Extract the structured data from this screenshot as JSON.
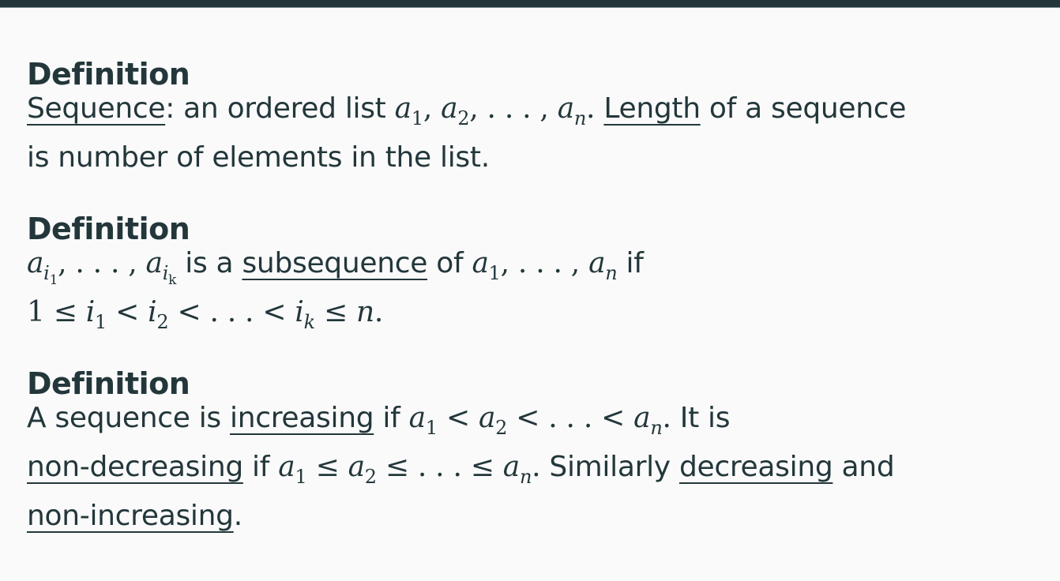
{
  "colors": {
    "text": "#23373b",
    "background": "#fafafa",
    "topbar": "#23373b"
  },
  "blocks": [
    {
      "title": "Definition",
      "lines": [
        [
          {
            "k": "u",
            "v": "Sequence"
          },
          {
            "k": "t",
            "v": ": an ordered list "
          },
          {
            "k": "m",
            "v": "a"
          },
          {
            "k": "s",
            "v": "1"
          },
          {
            "k": "r",
            "v": ", "
          },
          {
            "k": "m",
            "v": "a"
          },
          {
            "k": "s",
            "v": "2"
          },
          {
            "k": "r",
            "v": ", . . . , "
          },
          {
            "k": "m",
            "v": "a"
          },
          {
            "k": "si",
            "v": "n"
          },
          {
            "k": "r",
            "v": ". "
          },
          {
            "k": "u",
            "v": "Length"
          },
          {
            "k": "t",
            "v": " of a sequence"
          }
        ],
        [
          {
            "k": "t",
            "v": "is number of elements in the list."
          }
        ]
      ]
    },
    {
      "title": "Definition",
      "lines": [
        [
          {
            "k": "m",
            "v": "a"
          },
          {
            "k": "si",
            "v": "i"
          },
          {
            "k": "ss",
            "v": "1"
          },
          {
            "k": "r",
            "v": ", . . . , "
          },
          {
            "k": "m",
            "v": "a"
          },
          {
            "k": "si",
            "v": "i"
          },
          {
            "k": "ss",
            "v": "k"
          },
          {
            "k": "t",
            "v": " is a "
          },
          {
            "k": "u",
            "v": "subsequence"
          },
          {
            "k": "t",
            "v": " of "
          },
          {
            "k": "m",
            "v": "a"
          },
          {
            "k": "s",
            "v": "1"
          },
          {
            "k": "r",
            "v": ", . . . , "
          },
          {
            "k": "m",
            "v": "a"
          },
          {
            "k": "si",
            "v": "n"
          },
          {
            "k": "t",
            "v": " if"
          }
        ],
        [
          {
            "k": "r",
            "v": "1 ≤ "
          },
          {
            "k": "m",
            "v": "i"
          },
          {
            "k": "s",
            "v": "1"
          },
          {
            "k": "r",
            "v": " < "
          },
          {
            "k": "m",
            "v": "i"
          },
          {
            "k": "s",
            "v": "2"
          },
          {
            "k": "r",
            "v": " < . . . < "
          },
          {
            "k": "m",
            "v": "i"
          },
          {
            "k": "si",
            "v": "k"
          },
          {
            "k": "r",
            "v": " ≤ "
          },
          {
            "k": "m",
            "v": "n"
          },
          {
            "k": "r",
            "v": "."
          }
        ]
      ]
    },
    {
      "title": "Definition",
      "lines": [
        [
          {
            "k": "t",
            "v": "A sequence is "
          },
          {
            "k": "u",
            "v": "increasing"
          },
          {
            "k": "t",
            "v": " if "
          },
          {
            "k": "m",
            "v": "a"
          },
          {
            "k": "s",
            "v": "1"
          },
          {
            "k": "r",
            "v": " < "
          },
          {
            "k": "m",
            "v": "a"
          },
          {
            "k": "s",
            "v": "2"
          },
          {
            "k": "r",
            "v": " < . . . < "
          },
          {
            "k": "m",
            "v": "a"
          },
          {
            "k": "si",
            "v": "n"
          },
          {
            "k": "r",
            "v": ". "
          },
          {
            "k": "t",
            "v": "It is"
          }
        ],
        [
          {
            "k": "u",
            "v": "non-decreasing"
          },
          {
            "k": "t",
            "v": " if "
          },
          {
            "k": "m",
            "v": "a"
          },
          {
            "k": "s",
            "v": "1"
          },
          {
            "k": "r",
            "v": " ≤ "
          },
          {
            "k": "m",
            "v": "a"
          },
          {
            "k": "s",
            "v": "2"
          },
          {
            "k": "r",
            "v": " ≤ . . . ≤ "
          },
          {
            "k": "m",
            "v": "a"
          },
          {
            "k": "si",
            "v": "n"
          },
          {
            "k": "r",
            "v": ". "
          },
          {
            "k": "t",
            "v": "Similarly "
          },
          {
            "k": "u",
            "v": "decreasing"
          },
          {
            "k": "t",
            "v": " and"
          }
        ],
        [
          {
            "k": "u",
            "v": "non-increasing"
          },
          {
            "k": "t",
            "v": "."
          }
        ]
      ]
    }
  ]
}
